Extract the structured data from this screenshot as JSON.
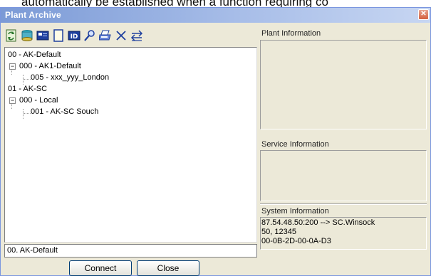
{
  "background": {
    "text": "automatically be established when a function requiring co"
  },
  "window": {
    "title": "Plant Archive",
    "close_glyph": "✕"
  },
  "toolbar": {
    "buttons": [
      {
        "name": "refresh-icon"
      },
      {
        "name": "database-icon"
      },
      {
        "name": "card-icon"
      },
      {
        "name": "blank-page-icon"
      },
      {
        "name": "id-icon"
      },
      {
        "name": "search-icon"
      },
      {
        "name": "print-icon"
      },
      {
        "name": "delete-icon"
      },
      {
        "name": "transfer-icon"
      }
    ]
  },
  "tree": {
    "items": [
      {
        "label": "00 - AK-Default"
      },
      {
        "label": "000 - AK1-Default",
        "expander": "−"
      },
      {
        "label": "005 - xxx_yyy_London"
      },
      {
        "label": "01 - AK-SC"
      },
      {
        "label": "000 - Local",
        "expander": "−"
      },
      {
        "label": "001 - AK-SC Souch"
      }
    ]
  },
  "selection": {
    "value": "00. AK-Default"
  },
  "buttons": {
    "connect": "Connect",
    "close": "Close"
  },
  "panels": {
    "plant_info": {
      "label": "Plant Information"
    },
    "service_info": {
      "label": "Service Information"
    },
    "system_info": {
      "label": "System Information",
      "lines": [
        "87.54.48.50:200 --> SC.Winsock",
        "50, 12345",
        "00-0B-2D-00-0A-D3"
      ]
    }
  },
  "colors": {
    "title_bar": "#7b9ad6",
    "dialog_bg": "#ece9d8",
    "close_button": "#d3603f"
  }
}
